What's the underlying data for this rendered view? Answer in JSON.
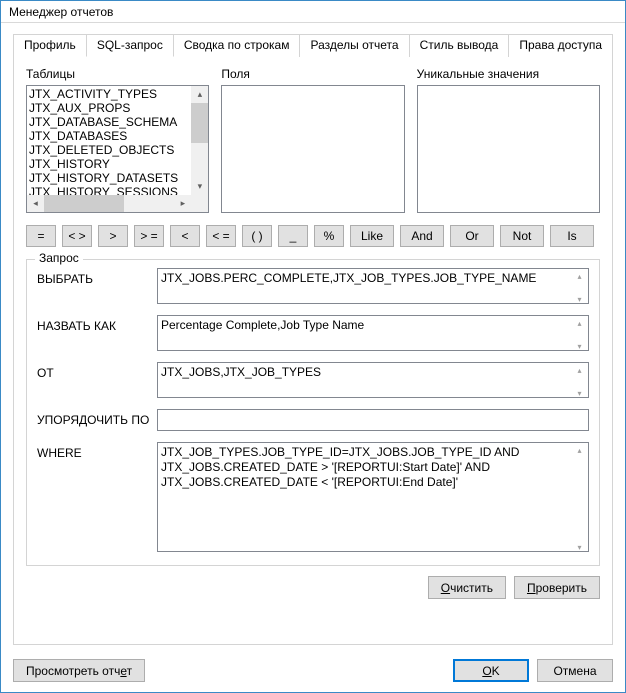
{
  "window_title": "Менеджер отчетов",
  "tabs": {
    "profile": "Профиль",
    "sql": "SQL-запрос",
    "summary": "Сводка по строкам",
    "sections": "Разделы отчета",
    "style": "Стиль вывода",
    "access": "Права доступа"
  },
  "labels": {
    "tables": "Таблицы",
    "fields": "Поля",
    "unique": "Уникальные значения",
    "query_legend": "Запрос",
    "select": "ВЫБРАТЬ",
    "alias": "НАЗВАТЬ КАК",
    "from": "ОТ",
    "orderby": "УПОРЯДОЧИТЬ ПО",
    "where": "WHERE"
  },
  "table_items": [
    "JTX_ACTIVITY_TYPES",
    "JTX_AUX_PROPS",
    "JTX_DATABASE_SCHEMA",
    "JTX_DATABASES",
    "JTX_DELETED_OBJECTS",
    "JTX_HISTORY",
    "JTX_HISTORY_DATASETS",
    "JTX_HISTORY_SESSIONS"
  ],
  "operators": {
    "eq": "=",
    "ne": "< >",
    "gt": ">",
    "ge": "> =",
    "lt": "<",
    "le": "< =",
    "paren": "( )",
    "underscore": "_",
    "percent": "%",
    "like": "Like",
    "and": "And",
    "or": "Or",
    "not": "Not",
    "is": "Is"
  },
  "query": {
    "select": "JTX_JOBS.PERC_COMPLETE,JTX_JOB_TYPES.JOB_TYPE_NAME",
    "alias": "Percentage Complete,Job Type Name",
    "from": "JTX_JOBS,JTX_JOB_TYPES",
    "orderby": "",
    "where": "JTX_JOB_TYPES.JOB_TYPE_ID=JTX_JOBS.JOB_TYPE_ID AND JTX_JOBS.CREATED_DATE > '[REPORTUI:Start Date]' AND JTX_JOBS.CREATED_DATE < '[REPORTUI:End Date]'"
  },
  "buttons": {
    "clear": "Очистить",
    "validate": "Проверить",
    "preview": "Просмотреть отчет",
    "ok": "K",
    "cancel": "Отмена"
  }
}
